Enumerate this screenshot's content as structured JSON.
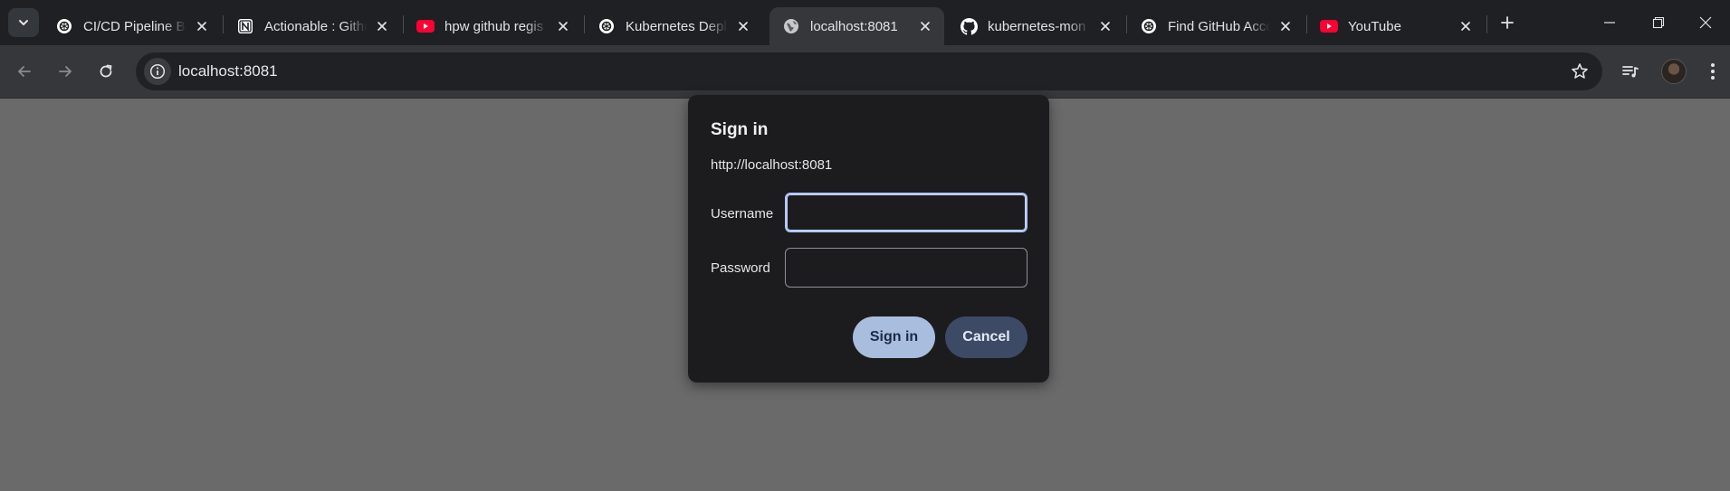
{
  "browser": {
    "tabs": [
      {
        "title": "CI/CD Pipeline Bu",
        "icon": "openai-icon",
        "active": false
      },
      {
        "title": "Actionable : Githu",
        "icon": "notion-icon",
        "active": false
      },
      {
        "title": "hpw github regis",
        "icon": "youtube-icon",
        "active": false
      },
      {
        "title": "Kubernetes Deplo",
        "icon": "openai-icon",
        "active": false
      },
      {
        "title": "localhost:8081",
        "icon": "globe-icon",
        "active": true
      },
      {
        "title": "kubernetes-mon",
        "icon": "github-icon",
        "active": false
      },
      {
        "title": "Find GitHub Acco",
        "icon": "openai-icon",
        "active": false
      },
      {
        "title": "YouTube",
        "icon": "youtube-icon",
        "active": false
      }
    ],
    "address_bar": {
      "url": "localhost:8081"
    }
  },
  "dialog": {
    "title": "Sign in",
    "origin": "http://localhost:8081",
    "username_label": "Username",
    "username_value": "",
    "password_label": "Password",
    "password_value": "",
    "sign_in_label": "Sign in",
    "cancel_label": "Cancel"
  },
  "colors": {
    "page_background": "#6a6a6a",
    "dialog_background": "#1c1c1e",
    "primary_button": "#a9bddf",
    "secondary_button": "#3c4a66",
    "focus_ring": "#aec6ff"
  }
}
